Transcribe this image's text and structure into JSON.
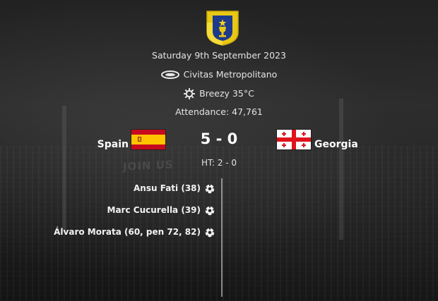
{
  "match": {
    "date": "Saturday 9th September 2023",
    "stadium": "Civitas Metropolitano",
    "weather": "Breezy 35°C",
    "attendance": "Attendance: 47,761",
    "halftime": "HT: 2 - 0",
    "score": "5 - 0",
    "background_text": "JOIN US"
  },
  "home": {
    "name": "Spain",
    "flag_colors": [
      "#c60b1e",
      "#ffc400",
      "#c60b1e"
    ]
  },
  "away": {
    "name": "Georgia",
    "flag_colors": [
      "#ffffff",
      "#e0121b"
    ]
  },
  "competition_logo_colors": {
    "primary": "#e8c814",
    "secondary": "#1e3a8a"
  },
  "icons": {
    "stadium": "stadium-icon",
    "weather": "weather-icon",
    "goal": "football-icon"
  },
  "home_scorers": [
    "Ansu Fati (38)",
    "Marc Cucurella (39)",
    "Álvaro Morata (60, pen 72, 82)"
  ]
}
